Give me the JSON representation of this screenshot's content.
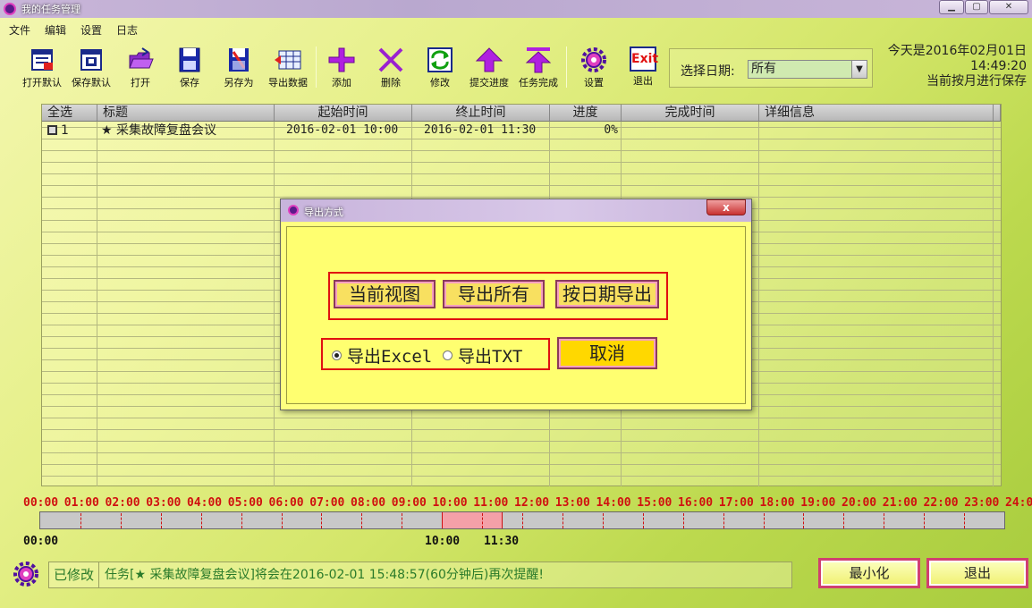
{
  "window": {
    "title": "我的任务管理"
  },
  "menu": [
    "文件",
    "编辑",
    "设置",
    "日志"
  ],
  "toolbar": [
    {
      "label": "打开默认",
      "icon": "open-default-icon"
    },
    {
      "label": "保存默认",
      "icon": "save-default-icon"
    },
    {
      "label": "打开",
      "icon": "folder-open-icon"
    },
    {
      "label": "保存",
      "icon": "floppy-disk-icon"
    },
    {
      "label": "另存为",
      "icon": "save-as-icon"
    },
    {
      "label": "导出数据",
      "icon": "export-table-icon"
    },
    {
      "label": "添加",
      "icon": "plus-icon"
    },
    {
      "label": "删除",
      "icon": "cross-icon"
    },
    {
      "label": "修改",
      "icon": "refresh-icon"
    },
    {
      "label": "提交进度",
      "icon": "arrow-up-icon"
    },
    {
      "label": "任务完成",
      "icon": "arrow-top-icon"
    },
    {
      "label": "设置",
      "icon": "gear-icon"
    },
    {
      "label": "退出",
      "icon": "exit-icon",
      "text": "Exit"
    }
  ],
  "date_filter": {
    "label": "选择日期:",
    "value": "所有"
  },
  "info": {
    "today": "今天是2016年02月01日",
    "time": "14:49:20",
    "mode": "当前按月进行保存"
  },
  "table": {
    "columns": [
      "全选",
      "标题",
      "起始时间",
      "终止时间",
      "进度",
      "完成时间",
      "详细信息"
    ],
    "rows": [
      {
        "no": "1",
        "title": "★ 采集故障复盘会议",
        "start": "2016-02-01 10:00",
        "end": "2016-02-01 11:30",
        "progress": "0%",
        "done": "",
        "detail": ""
      }
    ]
  },
  "timeline": {
    "hours": [
      "00:00",
      "01:00",
      "02:00",
      "03:00",
      "04:00",
      "05:00",
      "06:00",
      "07:00",
      "08:00",
      "09:00",
      "10:00",
      "11:00",
      "12:00",
      "13:00",
      "14:00",
      "15:00",
      "16:00",
      "17:00",
      "18:00",
      "19:00",
      "20:00",
      "21:00",
      "22:00",
      "23:00",
      "24:00"
    ],
    "start_label": "00:00",
    "task_start": "10:00",
    "task_end": "11:30",
    "task_start_hour": 10,
    "task_end_hour": 11.5
  },
  "status": {
    "modified": "已修改",
    "message": "任务[★ 采集故障复盘会议]将会在2016-02-01 15:48:57(60分钟后)再次提醒!"
  },
  "buttons": {
    "minimize": "最小化",
    "exit": "退出"
  },
  "dialog": {
    "title": "导出方式",
    "close": "x",
    "btn_current": "当前视图",
    "btn_all": "导出所有",
    "btn_bydate": "按日期导出",
    "opt_excel": "导出Excel",
    "opt_txt": "导出TXT",
    "selected": "excel",
    "btn_cancel": "取消"
  }
}
